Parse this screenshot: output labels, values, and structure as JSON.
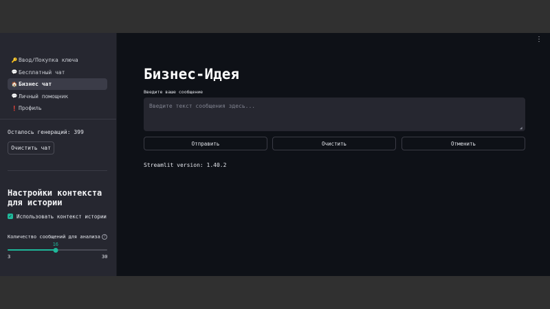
{
  "sidebar": {
    "nav": [
      {
        "icon": "🔑",
        "icon_name": "key-icon",
        "label": "Ввод/Покупка ключа",
        "active": false
      },
      {
        "icon": "💬",
        "icon_name": "speech-bubble-icon",
        "label": "Бесплатный чат",
        "active": false
      },
      {
        "icon": "🏠",
        "icon_name": "house-icon",
        "label": "Бизнес чат",
        "active": true
      },
      {
        "icon": "💬",
        "icon_name": "speech-bubble-icon",
        "label": "Личный помощник",
        "active": false
      },
      {
        "icon": "❗",
        "icon_name": "exclamation-icon",
        "label": "Профиль",
        "active": false
      }
    ],
    "generations_left": "Осталось генераций: 399",
    "clear_chat_label": "Очистить чат",
    "context_title": "Настройки контекста для истории",
    "use_context_label": "Использовать контекст истории",
    "use_context_checked": true,
    "slider": {
      "label": "Количество сообщений для анализа",
      "help": "?",
      "value": 16,
      "min": 3,
      "max": 30
    }
  },
  "main": {
    "menu": "⋮",
    "title": "Бизнес-Идея",
    "input_label": "Введите ваше сообщение",
    "input_placeholder": "Введите текст сообщения здесь...",
    "input_value": "",
    "buttons": {
      "send": "Отправить",
      "clear": "Очистить",
      "cancel": "Отменить"
    },
    "version": "Streamlit version: 1.40.2"
  },
  "colors": {
    "accent": "#1fb89a",
    "sidebar_bg": "#262730",
    "main_bg": "#0e1117"
  }
}
